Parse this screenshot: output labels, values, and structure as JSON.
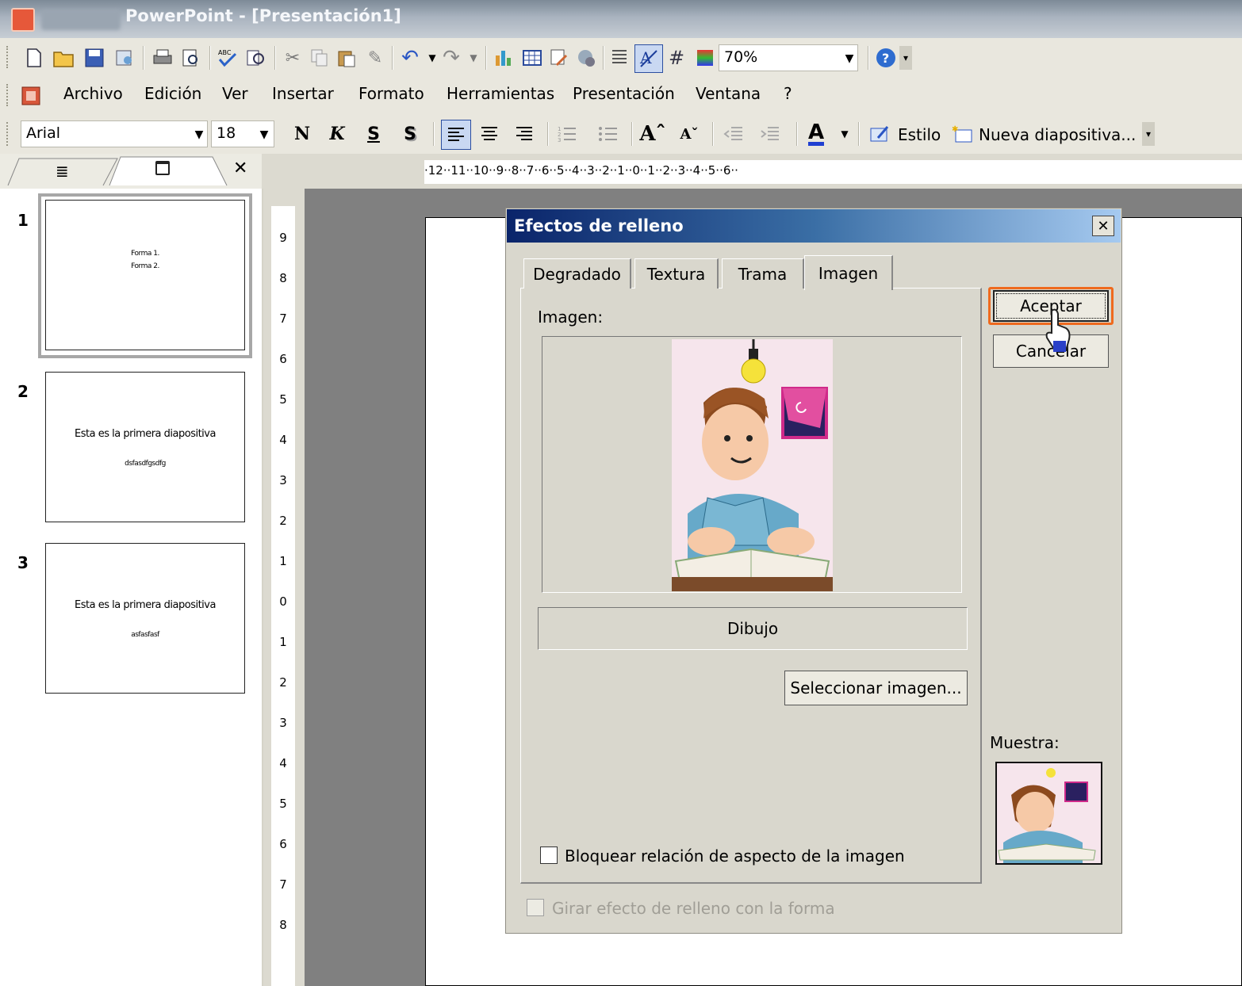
{
  "window": {
    "title": "PowerPoint - [Presentación1]"
  },
  "toolbar_standard": {
    "icons": [
      "new-icon",
      "open-icon",
      "save-icon",
      "permission-icon",
      "print-icon",
      "print-preview-icon",
      "spelling-icon",
      "research-icon",
      "cut-icon",
      "copy-icon",
      "paste-icon",
      "format-painter-icon",
      "undo-icon",
      "redo-icon",
      "insert-chart-icon",
      "insert-table-icon",
      "tables-borders-icon",
      "insert-hyperlink-icon",
      "expand-icon",
      "show-formatting-icon",
      "grid-icon",
      "color-grayscale-icon",
      "help-icon"
    ],
    "zoom_value": "70%"
  },
  "menu": {
    "items": [
      {
        "label": "Archivo"
      },
      {
        "label": "Edición"
      },
      {
        "label": "Ver"
      },
      {
        "label": "Insertar"
      },
      {
        "label": "Formato"
      },
      {
        "label": "Herramientas"
      },
      {
        "label": "Presentación"
      },
      {
        "label": "Ventana"
      },
      {
        "label": "?"
      }
    ]
  },
  "toolbar_format": {
    "font": "Arial",
    "size": "18",
    "bold": "N",
    "italic": "K",
    "underline": "S",
    "shadow": "S",
    "style_label": "Estilo",
    "new_slide_label": "Nueva diapositiva..."
  },
  "slides_pane": {
    "slides": [
      {
        "number": "1",
        "lines": [
          "Forma 1.",
          "Forma 2."
        ]
      },
      {
        "number": "2",
        "lines": [
          "Esta es la primera diapositiva",
          "dsfasdfgsdfg"
        ]
      },
      {
        "number": "3",
        "lines": [
          "Esta es la primera diapositiva",
          "asfasfasf"
        ]
      }
    ]
  },
  "ruler": {
    "horizontal": "·12··11··10··9··8··7··6··5··4··3··2··1··0··1··2··3··4··5··6··",
    "vertical": [
      "9",
      "8",
      "7",
      "6",
      "5",
      "4",
      "3",
      "2",
      "1",
      "0",
      "1",
      "2",
      "3",
      "4",
      "5",
      "6",
      "7",
      "8"
    ]
  },
  "dialog": {
    "title": "Efectos de relleno",
    "tabs": [
      "Degradado",
      "Textura",
      "Trama",
      "Imagen"
    ],
    "active_tab": "Imagen",
    "image_label": "Imagen:",
    "image_name": "Dibujo",
    "select_button": "Seleccionar imagen...",
    "lock_aspect_label": "Bloquear relación de aspecto de la imagen",
    "rotate_label": "Girar efecto de relleno con la forma",
    "ok_button": "Aceptar",
    "cancel_button": "Cancelar",
    "sample_label": "Muestra:",
    "highlight_color": "#ef6a1e"
  }
}
